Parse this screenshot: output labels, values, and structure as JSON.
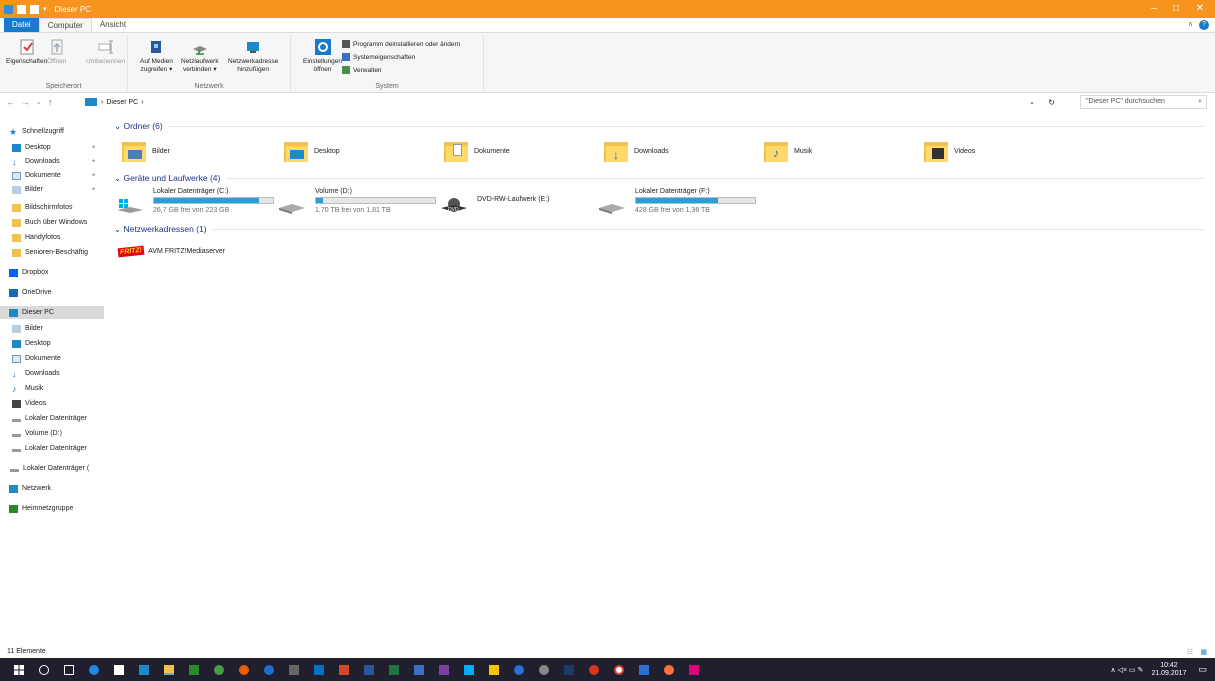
{
  "window": {
    "title": "Dieser PC",
    "minimize": "–",
    "maximize": "□",
    "close": "✕"
  },
  "tabs": [
    {
      "label": "Datei"
    },
    {
      "label": "Computer"
    },
    {
      "label": "Ansicht"
    }
  ],
  "ribbon": {
    "groups": [
      {
        "label": "Speicherort"
      },
      {
        "label": "Netzwerk"
      },
      {
        "label": "System"
      }
    ],
    "buttons": {
      "eigenschaften": "Eigenschaften",
      "oeffnen": "Öffnen",
      "umbenennen": "Umbenennen",
      "medien_l1": "Auf Medien",
      "medien_l2": "zugreifen ▾",
      "netzlaufwerk_l1": "Netzlaufwerk",
      "netzlaufwerk_l2": "verbinden ▾",
      "netzwerkadresse_l1": "Netzwerkadresse",
      "netzwerkadresse_l2": "hinzufügen",
      "einstellungen_l1": "Einstellungen",
      "einstellungen_l2": "öffnen",
      "programm": "Programm deinstallieren oder ändern",
      "systemeigenschaften": "Systemeigenschaften",
      "verwalten": "Verwalten"
    }
  },
  "address": {
    "back": "←",
    "forward": "→",
    "recent": "⌄",
    "up": "↑",
    "path": "Dieser PC",
    "refresh": "↻",
    "search_placeholder": "\"Dieser PC\" durchsuchen"
  },
  "sidebar": {
    "items": [
      {
        "label": "Schnellzugriff",
        "icon": "star-icon"
      },
      {
        "label": "Desktop",
        "icon": "desktop-icon",
        "pinned": true
      },
      {
        "label": "Downloads",
        "icon": "download-icon",
        "pinned": true
      },
      {
        "label": "Dokumente",
        "icon": "document-icon",
        "pinned": true
      },
      {
        "label": "Bilder",
        "icon": "pictures-icon",
        "pinned": true
      },
      {
        "label": "Bildschirmfotos",
        "icon": "folder-icon"
      },
      {
        "label": "Buch über Windows",
        "icon": "folder-icon"
      },
      {
        "label": "Handyfotos",
        "icon": "folder-icon"
      },
      {
        "label": "Senioren-Beschäftig",
        "icon": "folder-icon"
      },
      {
        "label": "Dropbox",
        "icon": "dropbox-icon"
      },
      {
        "label": "OneDrive",
        "icon": "onedrive-icon"
      },
      {
        "label": "Dieser PC",
        "icon": "computer-icon",
        "selected": true
      },
      {
        "label": "Bilder",
        "icon": "pictures-icon"
      },
      {
        "label": "Desktop",
        "icon": "desktop-icon"
      },
      {
        "label": "Dokumente",
        "icon": "document-icon"
      },
      {
        "label": "Downloads",
        "icon": "download-icon"
      },
      {
        "label": "Musik",
        "icon": "music-icon"
      },
      {
        "label": "Videos",
        "icon": "video-icon"
      },
      {
        "label": "Lokaler Datenträger",
        "icon": "drive-icon"
      },
      {
        "label": "Volume (D:)",
        "icon": "drive-icon"
      },
      {
        "label": "Lokaler Datenträger",
        "icon": "drive-icon"
      },
      {
        "label": "Lokaler Datenträger (",
        "icon": "drive-icon"
      },
      {
        "label": "Netzwerk",
        "icon": "network-icon"
      },
      {
        "label": "Heimnetzgruppe",
        "icon": "homegroup-icon"
      }
    ]
  },
  "groups": {
    "folders_title": "Ordner (6)",
    "drives_title": "Geräte und Laufwerke (4)",
    "network_title": "Netzwerkadressen (1)"
  },
  "folders": [
    {
      "label": "Bilder"
    },
    {
      "label": "Desktop"
    },
    {
      "label": "Dokumente"
    },
    {
      "label": "Downloads"
    },
    {
      "label": "Musik"
    },
    {
      "label": "Videos"
    }
  ],
  "drives": [
    {
      "name": "Lokaler Datenträger (C:)",
      "free": "26,7 GB frei von 223 GB",
      "used_fraction": 0.88
    },
    {
      "name": "Volume (D:)",
      "free": "1,70 TB frei von 1,81 TB",
      "used_fraction": 0.06
    },
    {
      "name": "DVD-RW-Laufwerk (E:)",
      "free": ""
    },
    {
      "name": "Lokaler Datenträger (F:)",
      "free": "428 GB frei von 1,36 TB",
      "used_fraction": 0.69
    }
  ],
  "network": [
    {
      "label": "AVM FRITZ!Mediaserver",
      "logo": "FRITZ!"
    }
  ],
  "status": {
    "count": "11 Elemente"
  },
  "taskbar": {
    "time": "10:42",
    "date": "21.09.2017",
    "tray_symbols": "∧  ◁×  ▭  ✎"
  },
  "colors": {
    "titlebar": "#f7941d",
    "accent": "#1979ca",
    "bar_fill": "#26a0da",
    "taskbar": "#1f1f2e"
  }
}
